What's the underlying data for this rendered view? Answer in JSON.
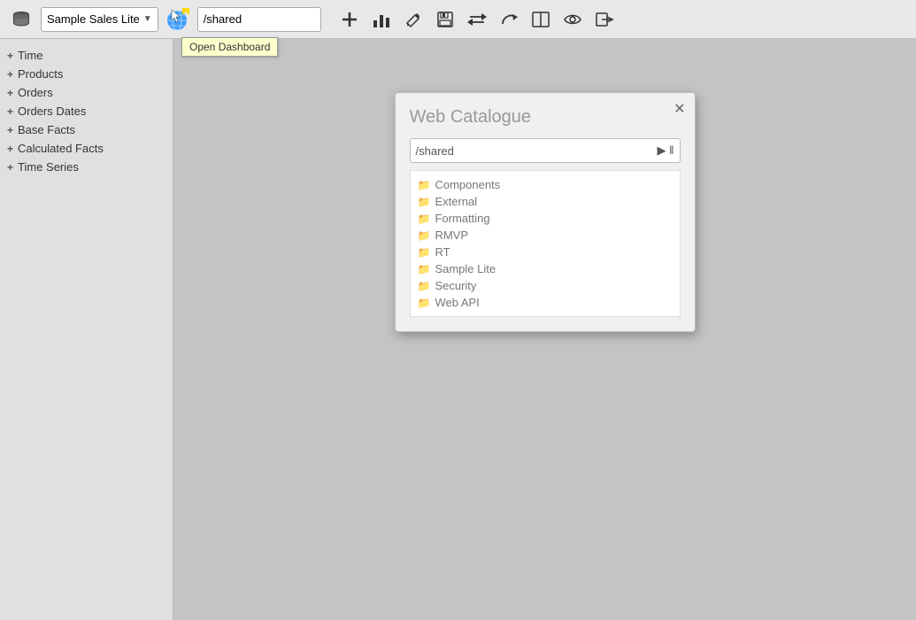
{
  "toolbar": {
    "datasource_label": "Sample Sales Lite",
    "path_value": "/shared",
    "add_label": "+",
    "tooltip_open_dashboard": "Open Dashboard"
  },
  "sidebar": {
    "items": [
      {
        "label": "Time",
        "id": "time"
      },
      {
        "label": "Products",
        "id": "products"
      },
      {
        "label": "Orders",
        "id": "orders"
      },
      {
        "label": "Orders Dates",
        "id": "orders-dates"
      },
      {
        "label": "Base Facts",
        "id": "base-facts"
      },
      {
        "label": "Calculated Facts",
        "id": "calculated-facts"
      },
      {
        "label": "Time Series",
        "id": "time-series"
      }
    ]
  },
  "dialog": {
    "title": "Web Catalogue",
    "path": "/shared",
    "folders": [
      {
        "name": "Components"
      },
      {
        "name": "External"
      },
      {
        "name": "Formatting"
      },
      {
        "name": "RMVP"
      },
      {
        "name": "RT"
      },
      {
        "name": "Sample Lite"
      },
      {
        "name": "Security"
      },
      {
        "name": "Web API"
      }
    ]
  }
}
